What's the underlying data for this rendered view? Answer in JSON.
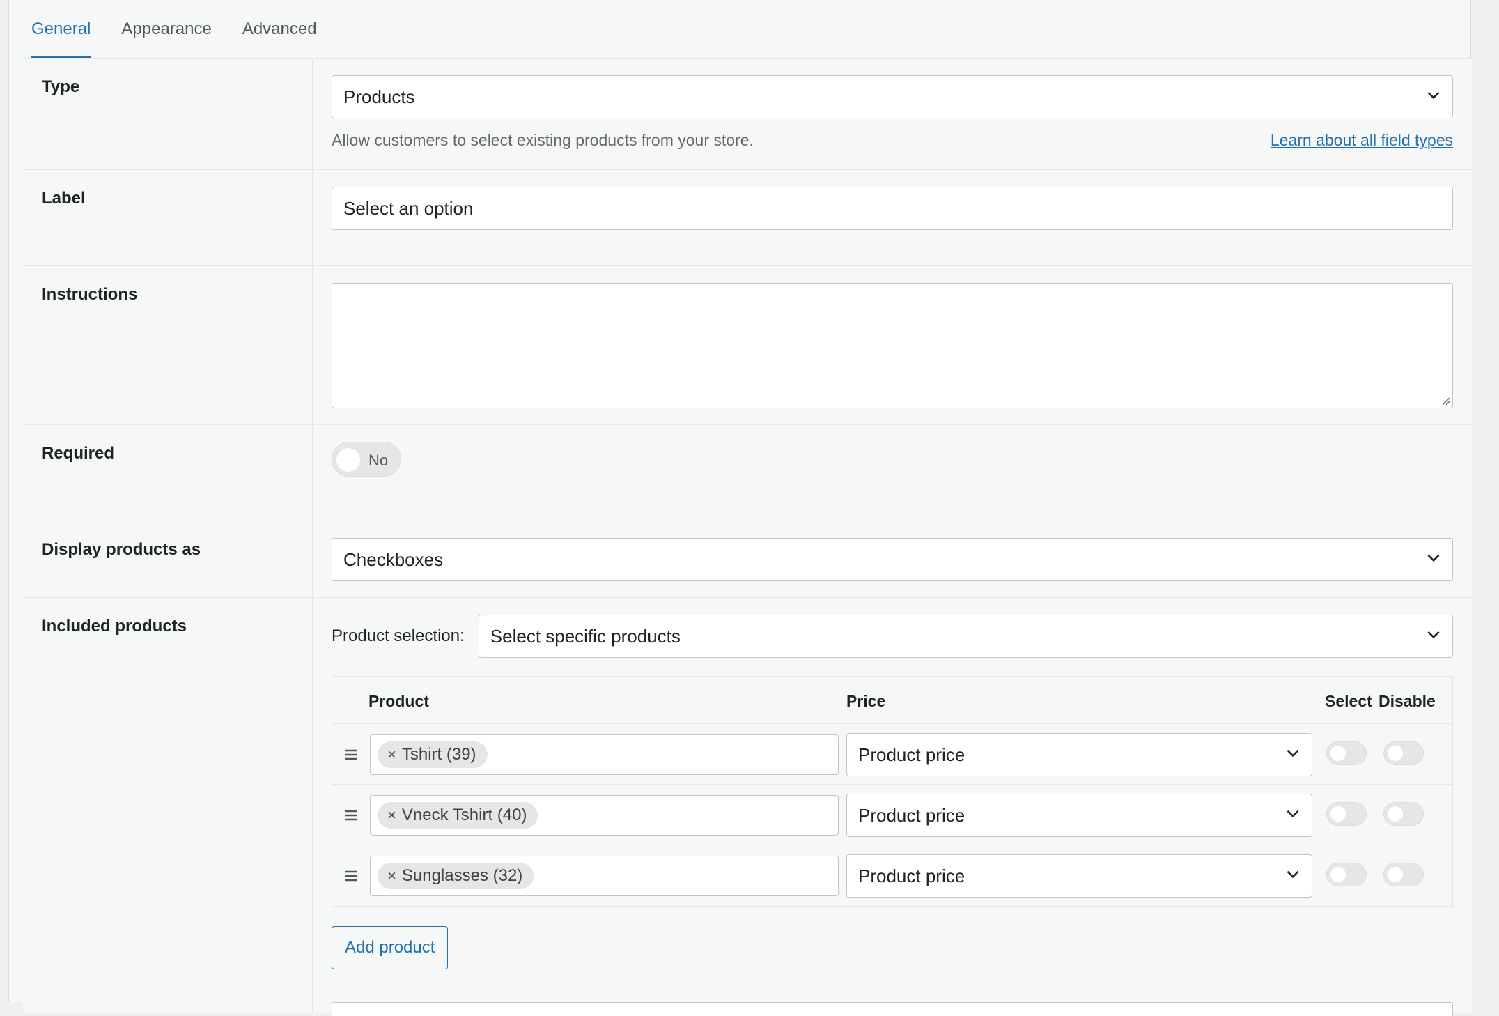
{
  "tabs": [
    {
      "label": "General",
      "active": true
    },
    {
      "label": "Appearance",
      "active": false
    },
    {
      "label": "Advanced",
      "active": false
    }
  ],
  "type_row": {
    "label": "Type",
    "value": "Products",
    "help": "Allow customers to select existing products from your store.",
    "link": "Learn about all field types"
  },
  "label_row": {
    "label": "Label",
    "value": "Select an option"
  },
  "instructions_row": {
    "label": "Instructions",
    "value": ""
  },
  "required_row": {
    "label": "Required",
    "toggle_text": "No",
    "enabled": false
  },
  "display_row": {
    "label": "Display products as",
    "value": "Checkboxes"
  },
  "included_row": {
    "label": "Included products",
    "selection_label": "Product selection:",
    "selection_value": "Select specific products",
    "columns": {
      "product": "Product",
      "price": "Price",
      "select": "Select",
      "disable": "Disable"
    },
    "products": [
      {
        "name": "Tshirt (39)",
        "price": "Product price",
        "select": false,
        "disable": false
      },
      {
        "name": "Vneck Tshirt (40)",
        "price": "Product price",
        "select": false,
        "disable": false
      },
      {
        "name": "Sunglasses (32)",
        "price": "Product price",
        "select": false,
        "disable": false
      }
    ],
    "add_button": "Add product"
  },
  "colors": {
    "accent": "#2271b1",
    "background": "#f6f7f7",
    "border": "#c3c4c7"
  }
}
